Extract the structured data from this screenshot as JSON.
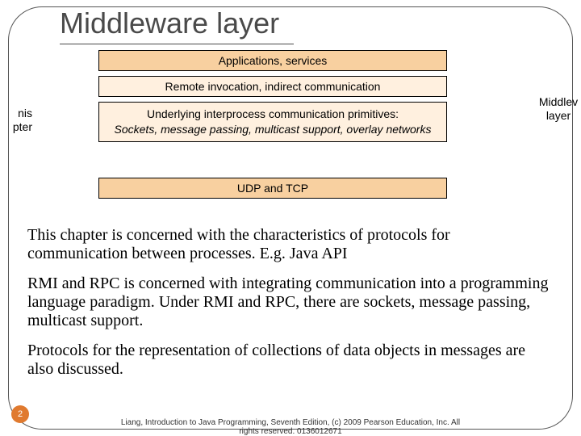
{
  "title": "Middleware layer",
  "layers": {
    "apps": "Applications, services",
    "remote": "Remote invocation, indirect communication",
    "ipc_line1": "Underlying interprocess communication primitives:",
    "ipc_line2": "Sockets, message passing, multicast support, overlay networks",
    "transport": "UDP and TCP"
  },
  "labels": {
    "left_line1": "nis",
    "left_line2": "pter",
    "right_line1": "Middlev",
    "right_line2": "layer"
  },
  "paragraphs": {
    "p1": "This chapter is concerned with the characteristics of protocols for communication between processes. E.g. Java API",
    "p2": "RMI and RPC is concerned with integrating communication into a programming language paradigm. Under RMI and RPC, there are sockets, message passing, multicast support.",
    "p3": "Protocols for the representation of collections of data objects in messages are also discussed."
  },
  "page": "2",
  "footer_line1": "Liang, Introduction to Java Programming, Seventh Edition, (c) 2009 Pearson Education, Inc. All",
  "footer_line2": "rights reserved. 0136012671"
}
